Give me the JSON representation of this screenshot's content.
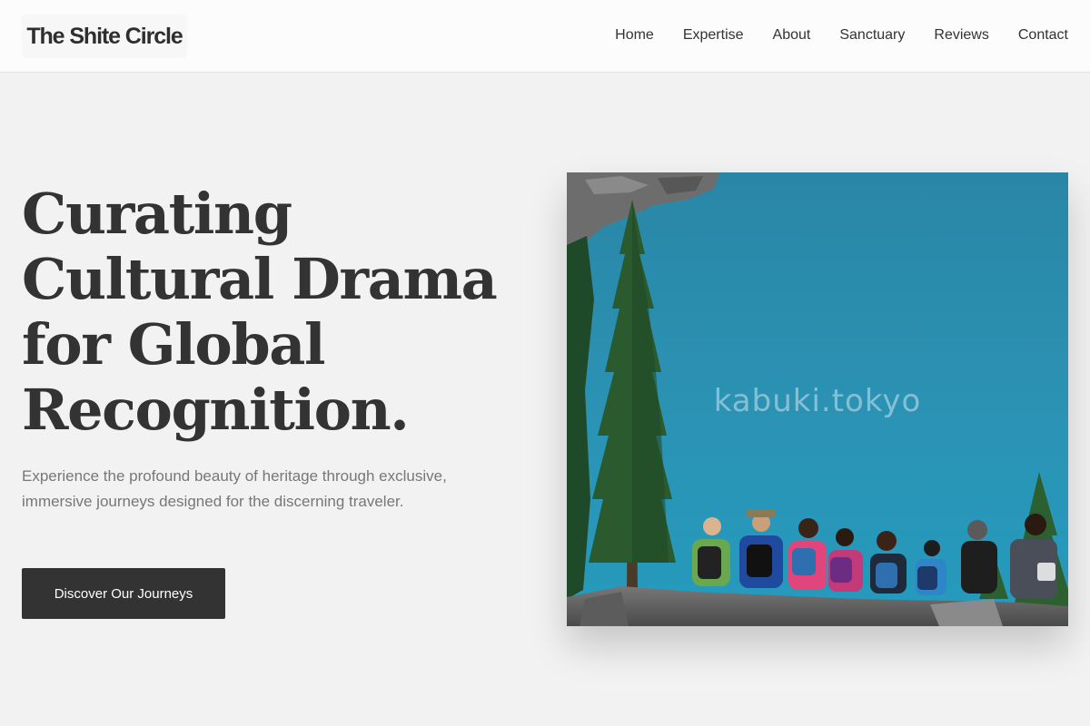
{
  "header": {
    "logo": "The Shite Circle",
    "nav": [
      "Home",
      "Expertise",
      "About",
      "Sanctuary",
      "Reviews",
      "Contact"
    ]
  },
  "hero": {
    "title_lines": [
      "Curating",
      "Cultural Drama",
      "for Global",
      "Recognition."
    ],
    "subtitle": "Experience the profound beauty of heritage through exclusive, immersive journeys designed for the discerning traveler.",
    "cta": "Discover Our Journeys"
  },
  "image": {
    "watermark": "kabuki.tokyo",
    "subject": "group of hikers seated on rocks overlooking a turquoise lake with evergreen trees"
  },
  "colors": {
    "background": "#f2f2f2",
    "header_bg": "#fcfcfc",
    "text": "#333333",
    "muted_text": "#777777",
    "button_bg": "#333333",
    "button_text": "#ffffff",
    "lake": "#2b8fae"
  }
}
